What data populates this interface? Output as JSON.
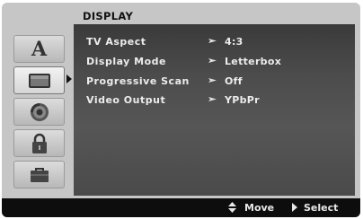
{
  "menu": {
    "title": "DISPLAY"
  },
  "sidebar": {
    "items": [
      {
        "name": "language",
        "glyph": "A",
        "icon": "letter-a-icon"
      },
      {
        "name": "display",
        "icon": "tv-icon",
        "active": true
      },
      {
        "name": "audio",
        "icon": "speaker-icon"
      },
      {
        "name": "lock",
        "icon": "padlock-icon"
      },
      {
        "name": "others",
        "icon": "briefcase-icon"
      }
    ]
  },
  "settings": [
    {
      "label": "TV Aspect",
      "value": "4:3"
    },
    {
      "label": "Display Mode",
      "value": "Letterbox"
    },
    {
      "label": "Progressive Scan",
      "value": "Off"
    },
    {
      "label": "Video Output",
      "value": "YPbPr"
    }
  ],
  "footer": {
    "move_label": "Move",
    "select_label": "Select"
  },
  "colors": {
    "screen_bg": "#c6c6c6",
    "panel_bg": "#4a4a4a",
    "footer_bg": "#0d0d0d",
    "text": "#ececec"
  }
}
